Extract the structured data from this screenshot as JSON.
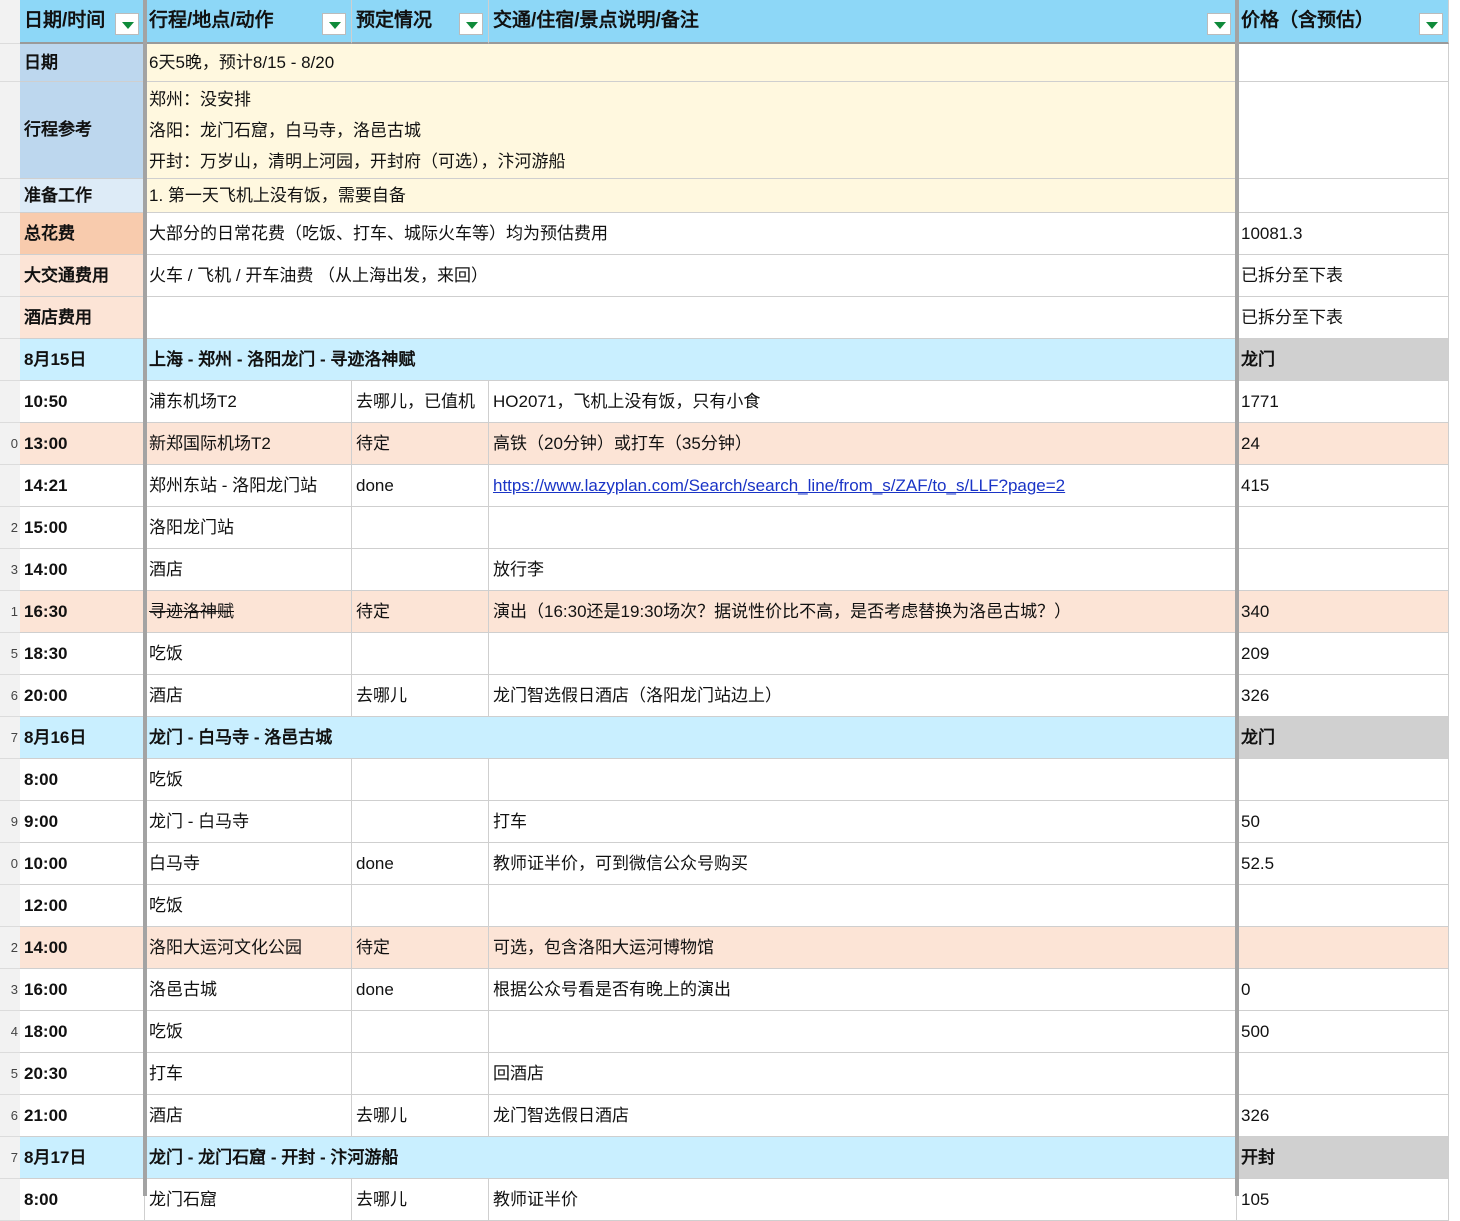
{
  "colors": {
    "header_bg": "#8dd7f7",
    "label_blue": "#bdd7ee",
    "label_lightblue": "#ddebf7",
    "label_orange": "#f8cbad",
    "label_peach": "#fce4d6",
    "cream": "#fff8df",
    "day_bg": "#c9efff",
    "gray_cell": "#d0d0d0",
    "pending_row": "#fce4d6",
    "white": "#ffffff"
  },
  "headers": [
    {
      "label": "日期/时间"
    },
    {
      "label": "行程/地点/动作"
    },
    {
      "label": "预定情况"
    },
    {
      "label": "交通/住宿/景点说明/备注"
    },
    {
      "label": "价格（含预估）"
    }
  ],
  "info_rows": [
    {
      "label": "日期",
      "content": [
        "6天5晚，预计8/15 - 8/20"
      ],
      "price": ""
    },
    {
      "label": "行程参考",
      "content": [
        "郑州：没安排",
        "洛阳：龙门石窟，白马寺，洛邑古城",
        "开封：万岁山，清明上河园，开封府（可选），汴河游船"
      ],
      "price": ""
    },
    {
      "label": "准备工作",
      "content": [
        "1. 第一天飞机上没有饭，需要自备"
      ],
      "price": ""
    },
    {
      "label": "总花费",
      "content": [
        "大部分的日常花费（吃饭、打车、城际火车等）均为预估费用"
      ],
      "price": "10081.3"
    },
    {
      "label": "大交通费用",
      "content": [
        "火车 / 飞机 / 开车油费 （从上海出发，来回）"
      ],
      "price": "已拆分至下表"
    },
    {
      "label": "酒店费用",
      "content": [
        ""
      ],
      "price": "已拆分至下表"
    }
  ],
  "days": [
    {
      "date": "8月15日",
      "route": "上海 - 郑州 - 洛阳龙门 - 寻迹洛神赋",
      "city": "龙门",
      "items": [
        {
          "row_no": "",
          "time": "10:50",
          "place": "浦东机场T2",
          "status": "去哪儿，已值机",
          "note": "HO2071，飞机上没有饭，只有小食",
          "price": "1771"
        },
        {
          "row_no": "0",
          "time": "13:00",
          "place": "新郑国际机场T2",
          "status": "待定",
          "note": "高铁（20分钟）或打车（35分钟）",
          "price": "24"
        },
        {
          "row_no": "",
          "time": "14:21",
          "place": "郑州东站 - 洛阳龙门站",
          "status": "done",
          "note": "https://www.lazyplan.com/Search/search_line/from_s/ZAF/to_s/LLF?page=2",
          "price": "415"
        },
        {
          "row_no": "2",
          "time": "15:00",
          "place": "洛阳龙门站",
          "status": "",
          "note": "",
          "price": ""
        },
        {
          "row_no": "3",
          "time": "14:00",
          "place": "酒店",
          "status": "",
          "note": "放行李",
          "price": ""
        },
        {
          "row_no": "1",
          "time": "16:30",
          "place": "寻迹洛神赋",
          "status": "待定",
          "note": "演出（16:30还是19:30场次？据说性价比不高，是否考虑替换为洛邑古城？）",
          "price": "340"
        },
        {
          "row_no": "5",
          "time": "18:30",
          "place": "吃饭",
          "status": "",
          "note": "",
          "price": "209"
        },
        {
          "row_no": "6",
          "time": "20:00",
          "place": "酒店",
          "status": "去哪儿",
          "note": "龙门智选假日酒店（洛阳龙门站边上）",
          "price": "326"
        }
      ]
    },
    {
      "date": "8月16日",
      "row_no": "7",
      "route": "龙门 - 白马寺 - 洛邑古城",
      "city": "龙门",
      "items": [
        {
          "row_no": "",
          "time": "8:00",
          "place": "吃饭",
          "status": "",
          "note": "",
          "price": ""
        },
        {
          "row_no": "9",
          "time": "9:00",
          "place": "龙门 - 白马寺",
          "status": "",
          "note": "打车",
          "price": "50"
        },
        {
          "row_no": "0",
          "time": "10:00",
          "place": "白马寺",
          "status": "done",
          "note": "教师证半价，可到微信公众号购买",
          "price": "52.5"
        },
        {
          "row_no": "",
          "time": "12:00",
          "place": "吃饭",
          "status": "",
          "note": "",
          "price": ""
        },
        {
          "row_no": "2",
          "time": "14:00",
          "place": "洛阳大运河文化公园",
          "status": "待定",
          "note": "可选，包含洛阳大运河博物馆",
          "price": ""
        },
        {
          "row_no": "3",
          "time": "16:00",
          "place": "洛邑古城",
          "status": "done",
          "note": "根据公众号看是否有晚上的演出",
          "price": "0"
        },
        {
          "row_no": "4",
          "time": "18:00",
          "place": "吃饭",
          "status": "",
          "note": "",
          "price": "500"
        },
        {
          "row_no": "5",
          "time": "20:30",
          "place": "打车",
          "status": "",
          "note": "回酒店",
          "price": ""
        },
        {
          "row_no": "6",
          "time": "21:00",
          "place": "酒店",
          "status": "去哪儿",
          "note": "龙门智选假日酒店",
          "price": "326"
        }
      ]
    },
    {
      "date": "8月17日",
      "row_no": "7",
      "route": "龙门 - 龙门石窟 - 开封 - 汴河游船",
      "city": "开封",
      "items": [
        {
          "row_no": "",
          "time": "8:00",
          "place": "龙门石窟",
          "status": "去哪儿",
          "note": "教师证半价",
          "price": "105"
        }
      ]
    }
  ]
}
